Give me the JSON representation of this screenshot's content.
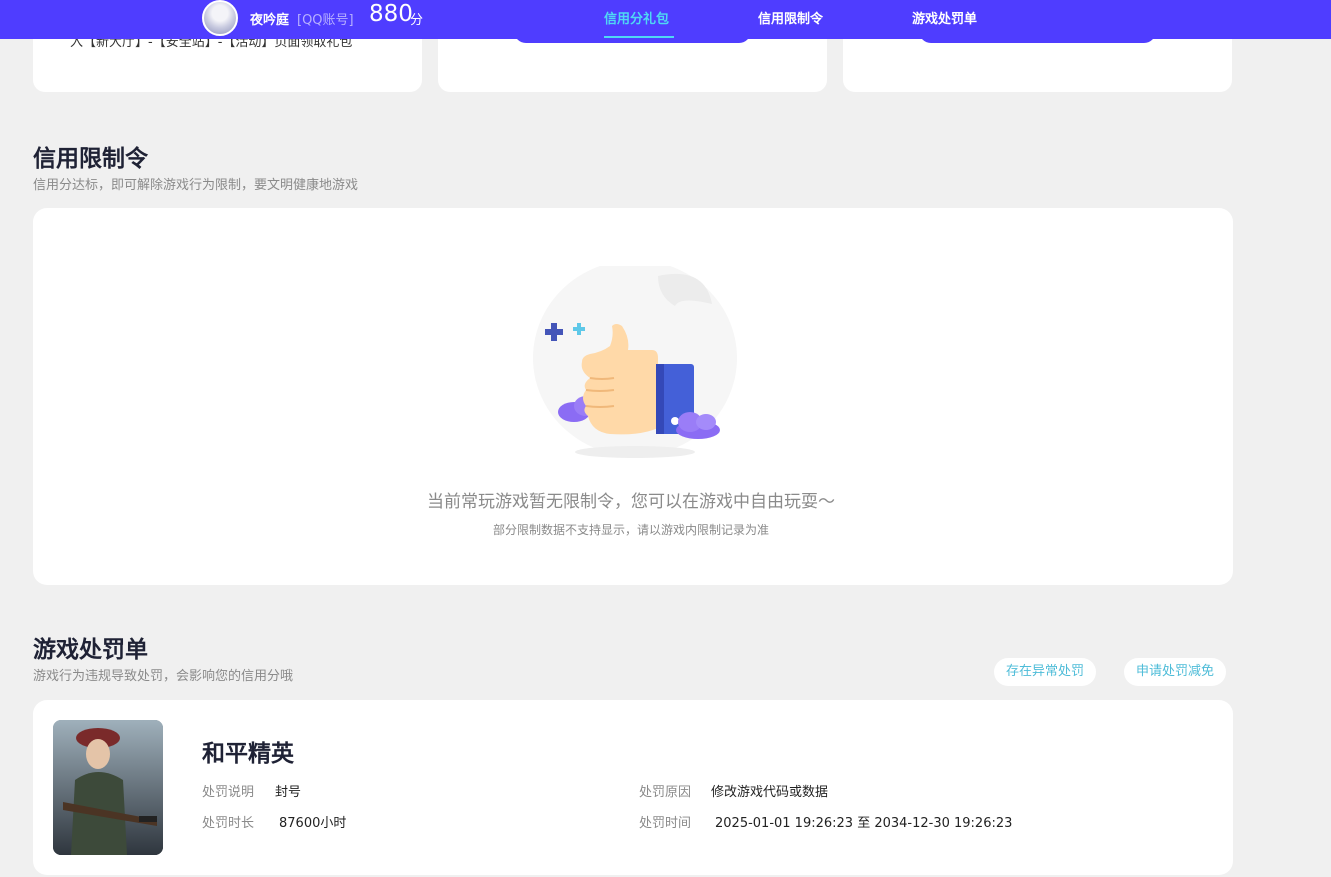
{
  "header": {
    "username": "夜吟庭",
    "account_type": "[QQ账号]",
    "score": "880",
    "score_unit": "分",
    "nav": [
      {
        "label": "信用分礼包",
        "active": true
      },
      {
        "label": "信用限制令",
        "active": false
      },
      {
        "label": "游戏处罚单",
        "active": false
      }
    ],
    "accent_color": "#4f3dff",
    "active_color": "#4fd8f4"
  },
  "top_cards": {
    "first_text": "入【新大厅】-【安全站】-【活动】页面领取礼包"
  },
  "restriction": {
    "title": "信用限制令",
    "subtitle": "信用分达标，即可解除游戏行为限制，要文明健康地游戏",
    "empty_main": "当前常玩游戏暂无限制令，您可以在游戏中自由玩耍～",
    "empty_sub": "部分限制数据不支持显示，请以游戏内限制记录为准"
  },
  "punishment": {
    "title": "游戏处罚单",
    "subtitle": "游戏行为违规导致处罚，会影响您的信用分哦",
    "buttons": [
      "存在异常处罚",
      "申请处罚减免"
    ],
    "game": {
      "name": "和平精英",
      "desc_label": "处罚说明",
      "desc_value": "封号",
      "duration_label": "处罚时长",
      "duration_value": "87600小时",
      "reason_label": "处罚原因",
      "reason_value": "修改游戏代码或数据",
      "time_label": "处罚时间",
      "time_value": "2025-01-01 19:26:23 至 2034-12-30 19:26:23"
    }
  }
}
